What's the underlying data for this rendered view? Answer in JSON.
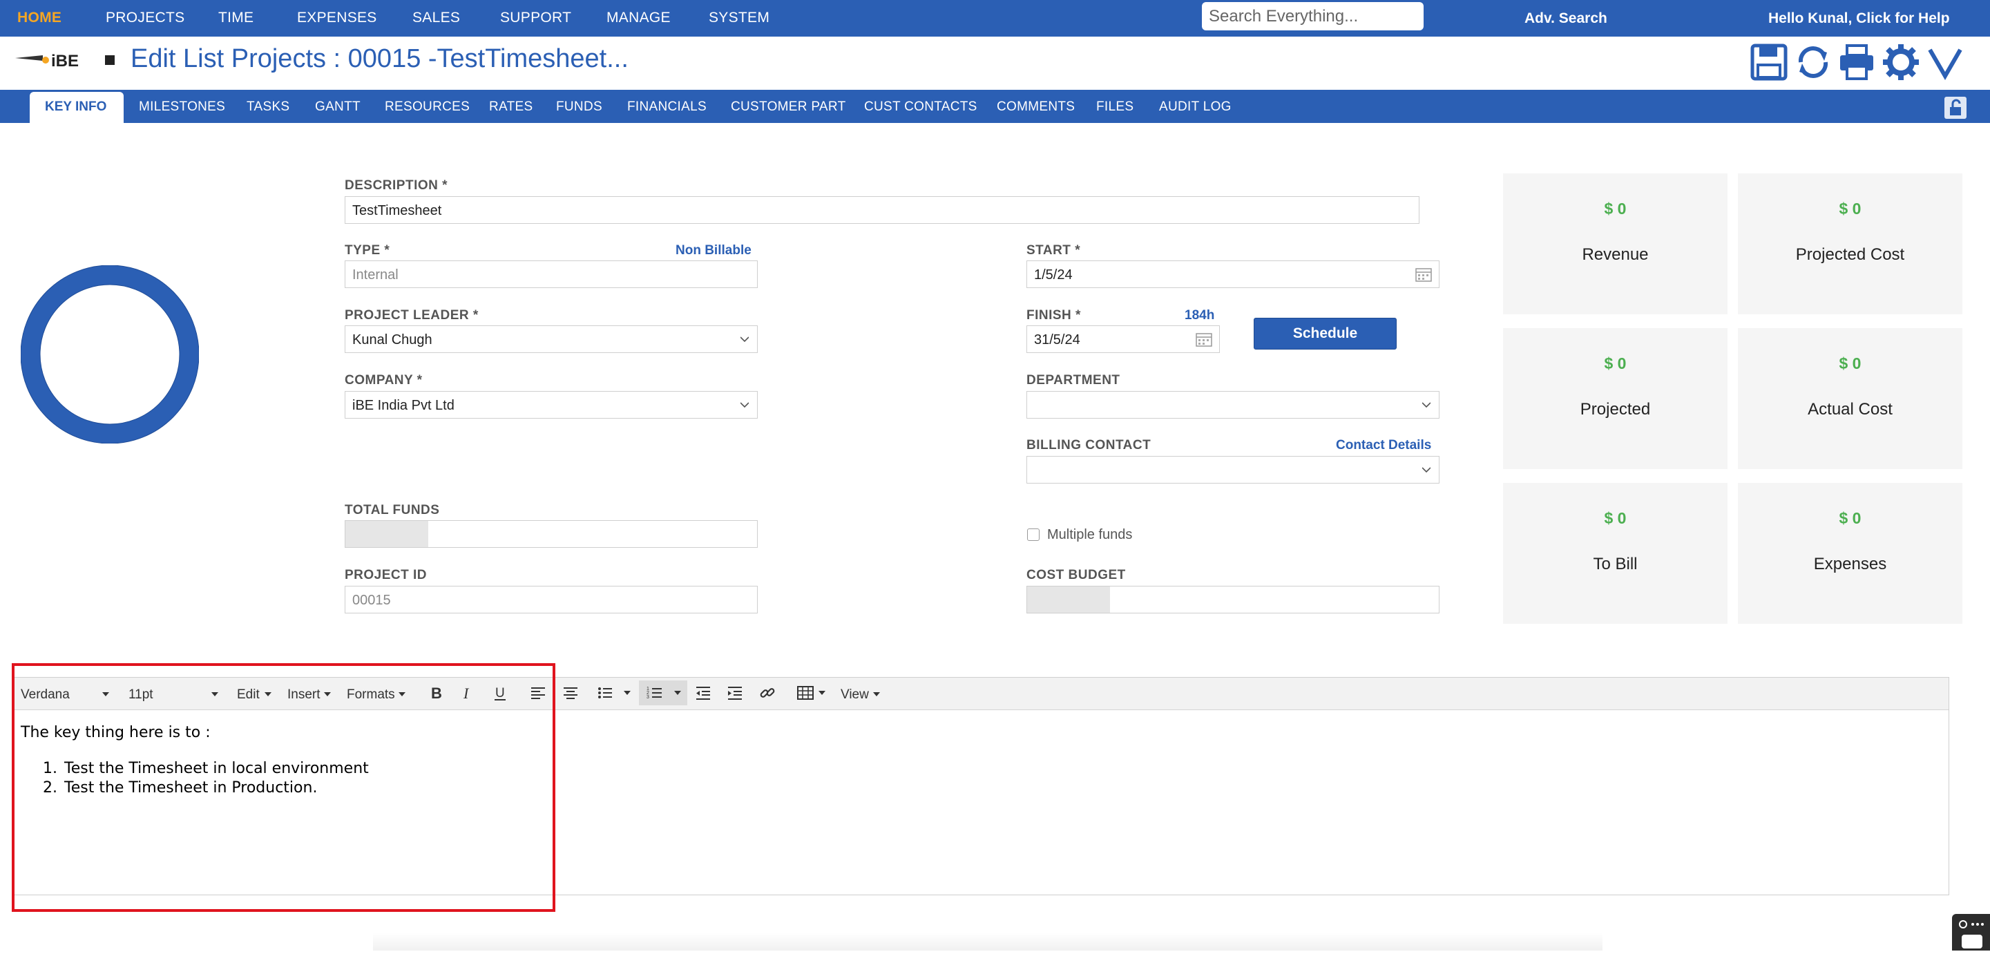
{
  "topnav": {
    "items": [
      "HOME",
      "PROJECTS",
      "TIME",
      "EXPENSES",
      "SALES",
      "SUPPORT",
      "MANAGE",
      "SYSTEM"
    ],
    "search_placeholder": "Search Everything...",
    "adv_search": "Adv. Search",
    "help": "Hello Kunal, Click for Help",
    "active_color": "#f5a623",
    "bar_color": "#2b5fb4"
  },
  "header": {
    "logo_text": "iBE",
    "title": "Edit List Projects : 00015 -TestTimesheet...",
    "toolbar_icons": [
      "save-icon",
      "refresh-icon",
      "print-icon",
      "gear-icon",
      "chevron-down-icon"
    ]
  },
  "tabs": [
    "KEY INFO",
    "MILESTONES",
    "TASKS",
    "GANTT",
    "RESOURCES",
    "RATES",
    "FUNDS",
    "FINANCIALS",
    "CUSTOMER PART",
    "CUST CONTACTS",
    "COMMENTS",
    "FILES",
    "AUDIT LOG"
  ],
  "form": {
    "description": {
      "label": "DESCRIPTION *",
      "value": "TestTimesheet"
    },
    "type": {
      "label": "TYPE *",
      "value": "Internal",
      "link": "Non Billable"
    },
    "project_leader": {
      "label": "PROJECT LEADER *",
      "value": "Kunal Chugh"
    },
    "company": {
      "label": "COMPANY *",
      "value": "iBE India Pvt Ltd"
    },
    "total_funds": {
      "label": "TOTAL FUNDS"
    },
    "project_id": {
      "label": "PROJECT ID",
      "value": "00015"
    },
    "start": {
      "label": "START *",
      "value": "1/5/24"
    },
    "finish": {
      "label": "FINISH *",
      "value": "31/5/24",
      "hours": "184h"
    },
    "schedule_button": "Schedule",
    "department": {
      "label": "DEPARTMENT",
      "value": ""
    },
    "billing_contact": {
      "label": "BILLING CONTACT",
      "value": "",
      "link": "Contact Details"
    },
    "multiple_funds": "Multiple funds",
    "cost_budget": {
      "label": "COST BUDGET"
    }
  },
  "cards": [
    {
      "amount": "$ 0",
      "name": "Revenue"
    },
    {
      "amount": "$ 0",
      "name": "Projected Cost"
    },
    {
      "amount": "$ 0",
      "name": "Projected"
    },
    {
      "amount": "$ 0",
      "name": "Actual Cost"
    },
    {
      "amount": "$ 0",
      "name": "To Bill"
    },
    {
      "amount": "$ 0",
      "name": "Expenses"
    }
  ],
  "editor": {
    "font": "Verdana",
    "size": "11pt",
    "menus": [
      "Edit",
      "Insert",
      "Formats",
      "View"
    ],
    "intro": "The key thing here is to :",
    "list": [
      "Test the Timesheet in local environment",
      "Test the Timesheet in Production."
    ]
  },
  "colors": {
    "amount": "#4caf50",
    "highlight": "#e0141e"
  }
}
